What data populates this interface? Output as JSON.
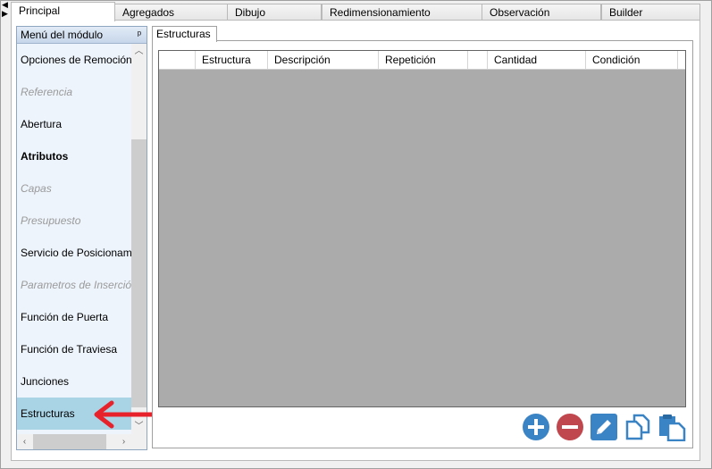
{
  "top_tabs": [
    {
      "label": "Principal",
      "active": true
    },
    {
      "label": "Agregados",
      "active": false
    },
    {
      "label": "Dibujo",
      "active": false
    },
    {
      "label": "Redimensionamiento",
      "active": false
    },
    {
      "label": "Observación",
      "active": false
    },
    {
      "label": "Builder",
      "active": false
    }
  ],
  "module_panel": {
    "title": "Menú del módulo",
    "pin_icon": "pin-icon",
    "items": [
      {
        "label": "Opciones de Remoción",
        "state": "normal"
      },
      {
        "label": "Referencia",
        "state": "disabled"
      },
      {
        "label": "Abertura",
        "state": "normal"
      },
      {
        "label": "Atributos",
        "state": "bold"
      },
      {
        "label": "Capas",
        "state": "disabled"
      },
      {
        "label": "Presupuesto",
        "state": "disabled"
      },
      {
        "label": "Servicio de Posicionamiento",
        "state": "normal"
      },
      {
        "label": "Parametros de Inserción",
        "state": "disabled"
      },
      {
        "label": "Función de Puerta",
        "state": "normal"
      },
      {
        "label": "Función de Traviesa",
        "state": "normal"
      },
      {
        "label": "Junciones",
        "state": "normal"
      },
      {
        "label": "Estructuras",
        "state": "selected"
      }
    ]
  },
  "inner_tab": {
    "label": "Estructuras"
  },
  "grid": {
    "columns": [
      "",
      "Estructura",
      "Descripción",
      "Repetición",
      "",
      "Cantidad",
      "Condición"
    ],
    "rows": []
  },
  "actions": [
    {
      "name": "add-icon",
      "color": "#3a83c5"
    },
    {
      "name": "remove-icon",
      "color": "#c0474d"
    },
    {
      "name": "edit-icon",
      "color": "#3a83c5"
    },
    {
      "name": "duplicate-icon",
      "color": "#3a83c5"
    },
    {
      "name": "paste-icon",
      "color": "#3a83c5"
    }
  ],
  "annotation_color": "#e8222a"
}
